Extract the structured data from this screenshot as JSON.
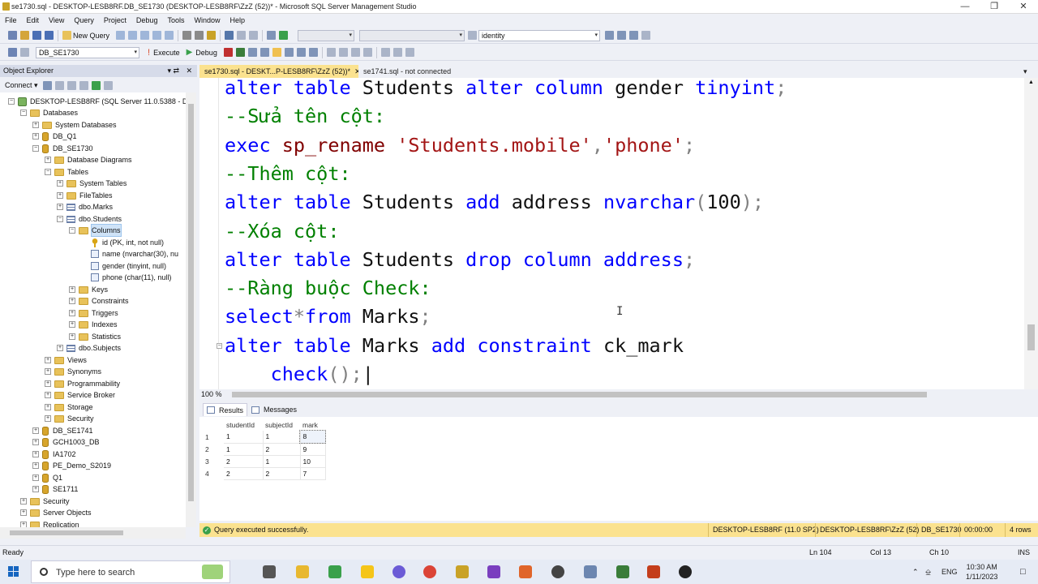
{
  "window": {
    "title": "se1730.sql - DESKTOP-LESB8RF.DB_SE1730 (DESKTOP-LESB8RF\\ZzZ (52))* - Microsoft SQL Server Management Studio"
  },
  "menu": [
    "File",
    "Edit",
    "View",
    "Query",
    "Project",
    "Debug",
    "Tools",
    "Window",
    "Help"
  ],
  "toolbar1": {
    "new_query": "New Query",
    "search_combo": "identity"
  },
  "toolbar2": {
    "database": "DB_SE1730",
    "execute": "Execute",
    "debug": "Debug"
  },
  "object_explorer": {
    "title": "Object Explorer",
    "connect": "Connect ▾",
    "tree": [
      "DESKTOP-LESB8RF (SQL Server 11.0.5388 - D",
      "Databases",
      "System Databases",
      "DB_Q1",
      "DB_SE1730",
      "Database Diagrams",
      "Tables",
      "System Tables",
      "FileTables",
      "dbo.Marks",
      "dbo.Students",
      "Columns",
      "id (PK, int, not null)",
      "name (nvarchar(30), nu",
      "gender (tinyint, null)",
      "phone (char(11), null)",
      "Keys",
      "Constraints",
      "Triggers",
      "Indexes",
      "Statistics",
      "dbo.Subjects",
      "Views",
      "Synonyms",
      "Programmability",
      "Service Broker",
      "Storage",
      "Security",
      "DB_SE1741",
      "GCH1003_DB",
      "IA1702",
      "PE_Demo_S2019",
      "Q1",
      "SE1711",
      "Security",
      "Server Objects",
      "Replication"
    ]
  },
  "tabs": {
    "active": "se1730.sql - DESKT...P-LESB8RF\\ZzZ (52))*",
    "inactive": "se1741.sql - not connected"
  },
  "editor": {
    "zoom": "100 %",
    "lines": {
      "l1": [
        "alter",
        " ",
        "table",
        " Students ",
        "alter",
        " ",
        "column",
        " gender ",
        "tinyint",
        ";"
      ],
      "l2": "--Sửa tên cột:",
      "l3": [
        "exec",
        " ",
        "sp_rename",
        " ",
        "'Students.mobile'",
        ",",
        "'phone'",
        ";"
      ],
      "l4": "--Thêm cột:",
      "l5": [
        "alter",
        " ",
        "table",
        " Students ",
        "add",
        " address ",
        "nvarchar",
        "(",
        "100",
        ");"
      ],
      "l6": "--Xóa cột:",
      "l7": [
        "alter",
        " ",
        "table",
        " Students ",
        "drop",
        " ",
        "column",
        " address",
        ";"
      ],
      "l8": "--Ràng buộc Check:",
      "l9": [
        "select",
        "*",
        "from",
        " Marks",
        ";"
      ],
      "l10": [
        "alter",
        " ",
        "table",
        " Marks ",
        "add",
        " ",
        "constraint",
        " ck_mark"
      ],
      "l11": [
        "    ",
        "check",
        "();"
      ]
    }
  },
  "results": {
    "tab_results": "Results",
    "tab_messages": "Messages",
    "columns": [
      "studentId",
      "subjectId",
      "mark"
    ],
    "rows": [
      [
        "1",
        "1",
        "1",
        "8"
      ],
      [
        "2",
        "1",
        "2",
        "9"
      ],
      [
        "3",
        "2",
        "1",
        "10"
      ],
      [
        "4",
        "2",
        "2",
        "7"
      ]
    ]
  },
  "query_status": {
    "message": "Query executed successfully.",
    "server": "DESKTOP-LESB8RF (11.0 SP2)",
    "user": "DESKTOP-LESB8RF\\ZzZ (52)",
    "database": "DB_SE1730",
    "elapsed": "00:00:00",
    "rows": "4 rows"
  },
  "statusbar": {
    "ready": "Ready",
    "ln": "Ln 104",
    "col": "Col 13",
    "ch": "Ch 10",
    "ins": "INS"
  },
  "taskbar": {
    "search_placeholder": "Type here to search",
    "lang": "ENG",
    "time": "10:30 AM",
    "date": "1/11/2023"
  },
  "colors": {
    "accent_tab": "#fbe28f",
    "keyword": "#0000ff",
    "comment": "#008000",
    "string": "#a31515"
  }
}
